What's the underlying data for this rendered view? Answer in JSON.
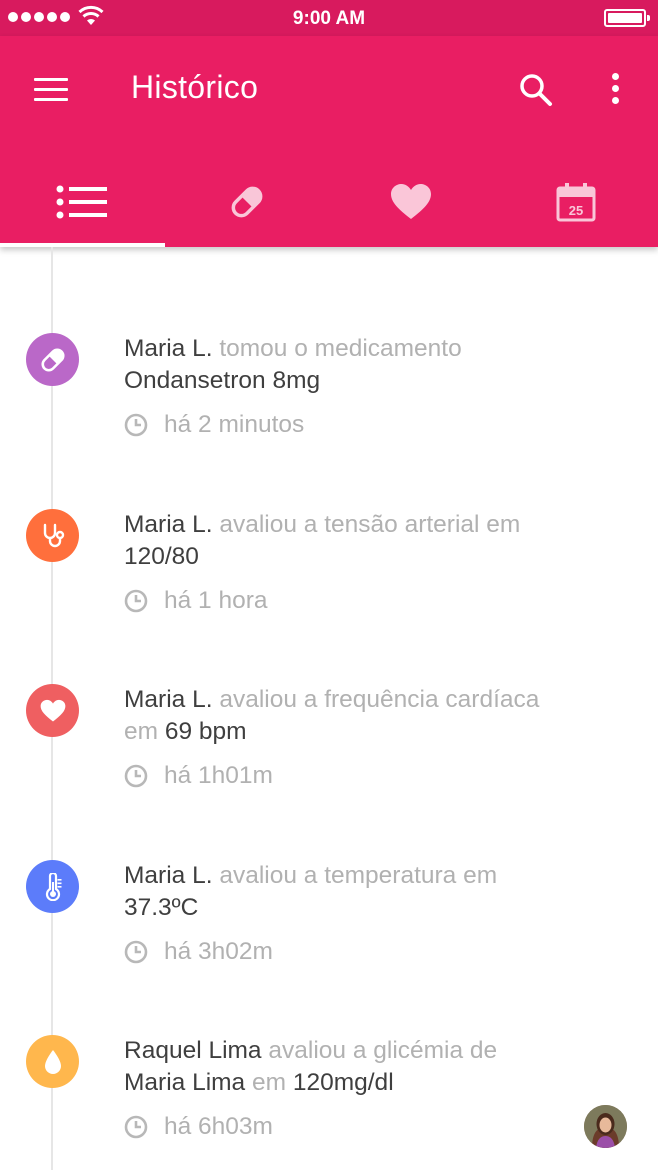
{
  "status_bar": {
    "time": "9:00 AM"
  },
  "app_bar": {
    "title": "Histórico"
  },
  "tabs": [
    {
      "name": "list",
      "icon": "list-icon"
    },
    {
      "name": "medication",
      "icon": "pill-icon"
    },
    {
      "name": "health",
      "icon": "heart-icon"
    },
    {
      "name": "calendar",
      "icon": "calendar-icon",
      "badge": "25"
    }
  ],
  "colors": {
    "status_bar": "#d81a5e",
    "app_bar": "#e91e63",
    "medication": "#ba68c8",
    "pressure": "#ff6f3c",
    "heart": "#ef5f61",
    "temperature": "#5c7cfa",
    "glucose": "#ffb74d"
  },
  "timeline": [
    {
      "icon": "pill-icon",
      "actor": "Maria L.",
      "action": " tomou o medicamento",
      "value": "Ondansetron 8mg",
      "time": "há 2 minutos"
    },
    {
      "icon": "stethoscope-icon",
      "actor": "Maria L.",
      "action": " avaliou a tensão arterial em",
      "value": "120/80",
      "time": "há 1 hora"
    },
    {
      "icon": "heart-icon",
      "actor": "Maria L.",
      "action": " avaliou a frequência cardíaca",
      "connector": "em ",
      "value": "69 bpm",
      "time": "há 1h01m"
    },
    {
      "icon": "thermometer-icon",
      "actor": "Maria L.",
      "action": " avaliou a temperatura em",
      "value": "37.3ºC",
      "time": "há 3h02m"
    },
    {
      "icon": "drop-icon",
      "actor": "Raquel Lima",
      "action": " avaliou a glicémia de",
      "subject": "Maria Lima",
      "connector": " em ",
      "value": "120mg/dl",
      "time": "há 6h03m"
    }
  ]
}
